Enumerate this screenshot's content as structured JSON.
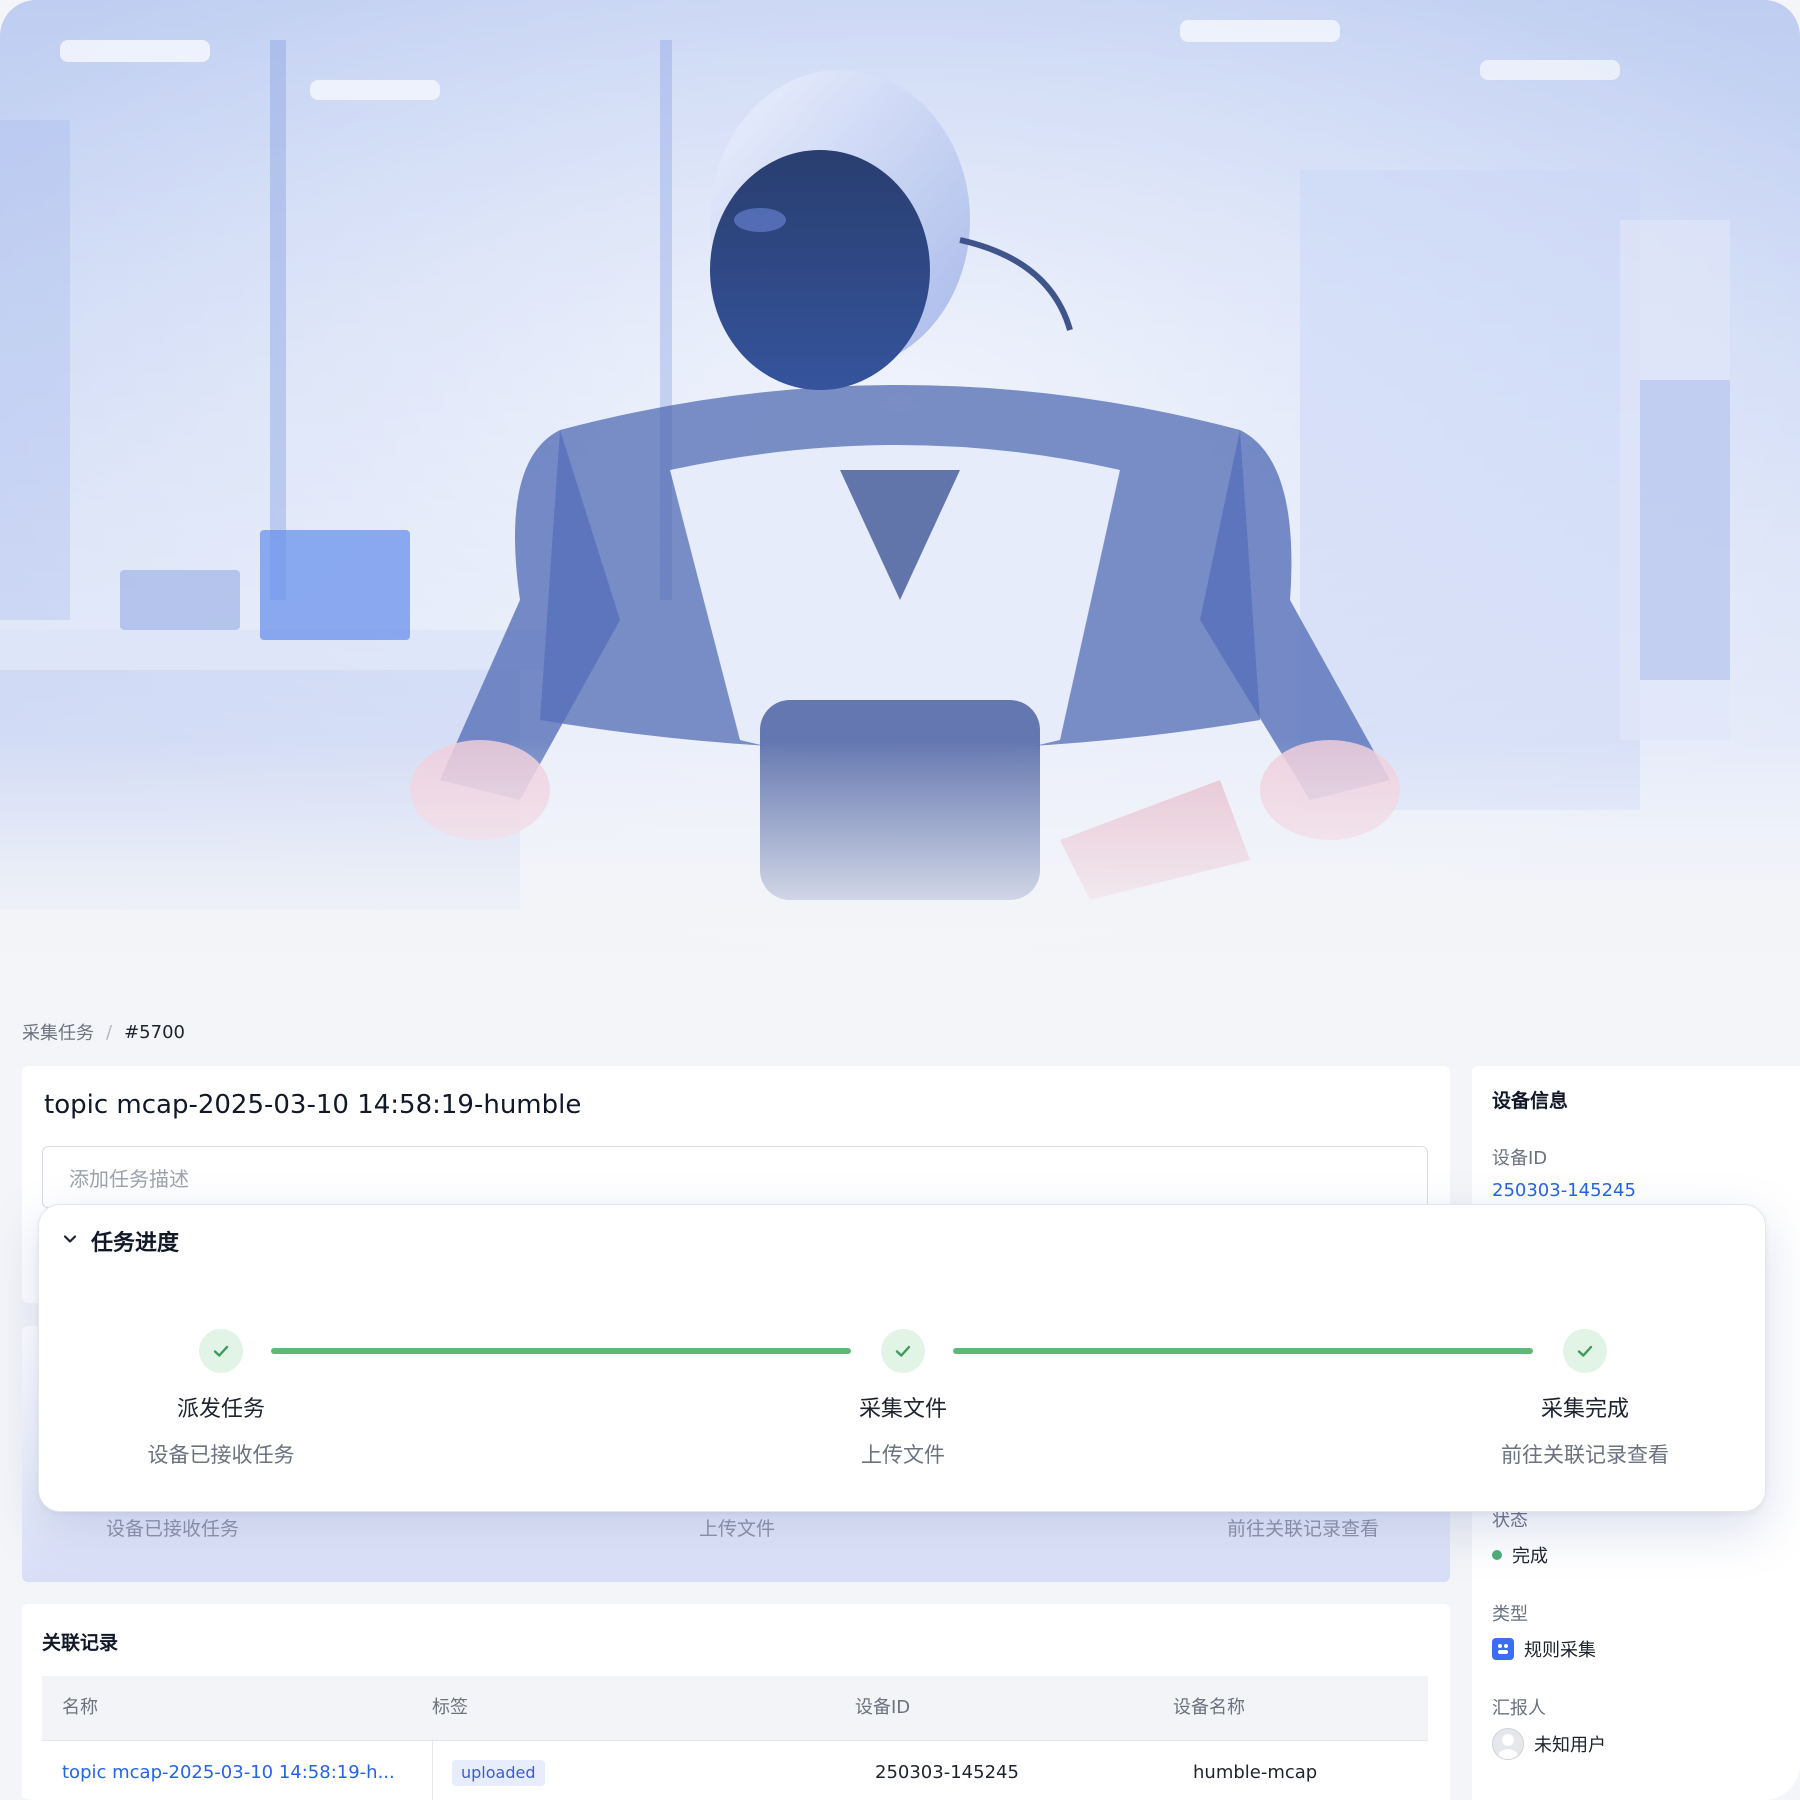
{
  "breadcrumb": {
    "parent": "采集任务",
    "separator": "/",
    "current": "#5700"
  },
  "task": {
    "title": "topic mcap-2025-03-10 14:58:19-humble",
    "description_placeholder": "添加任务描述"
  },
  "progress": {
    "title": "任务进度",
    "steps": [
      {
        "title": "派发任务",
        "subtitle": "设备已接收任务",
        "done": true
      },
      {
        "title": "采集文件",
        "subtitle": "上传文件",
        "done": true
      },
      {
        "title": "采集完成",
        "subtitle": "前往关联记录查看",
        "done": true
      }
    ],
    "accent": "#5fb87a"
  },
  "sidebar": {
    "heading": "设备信息",
    "device_id_label": "设备ID",
    "device_id_value": "250303-145245",
    "status_label": "状态",
    "status_value": "完成",
    "type_label": "类型",
    "type_value": "规则采集",
    "reporter_label": "汇报人",
    "reporter_value": "未知用户"
  },
  "records": {
    "title": "关联记录",
    "columns": [
      "名称",
      "标签",
      "设备ID",
      "设备名称"
    ],
    "rows": [
      {
        "name": "topic mcap-2025-03-10 14:58:19-h...",
        "tag": "uploaded",
        "device_id": "250303-145245",
        "device_name": "humble-mcap"
      }
    ]
  },
  "colors": {
    "link": "#2563eb",
    "success": "#4caf76",
    "brand": "#3b6ef5"
  }
}
